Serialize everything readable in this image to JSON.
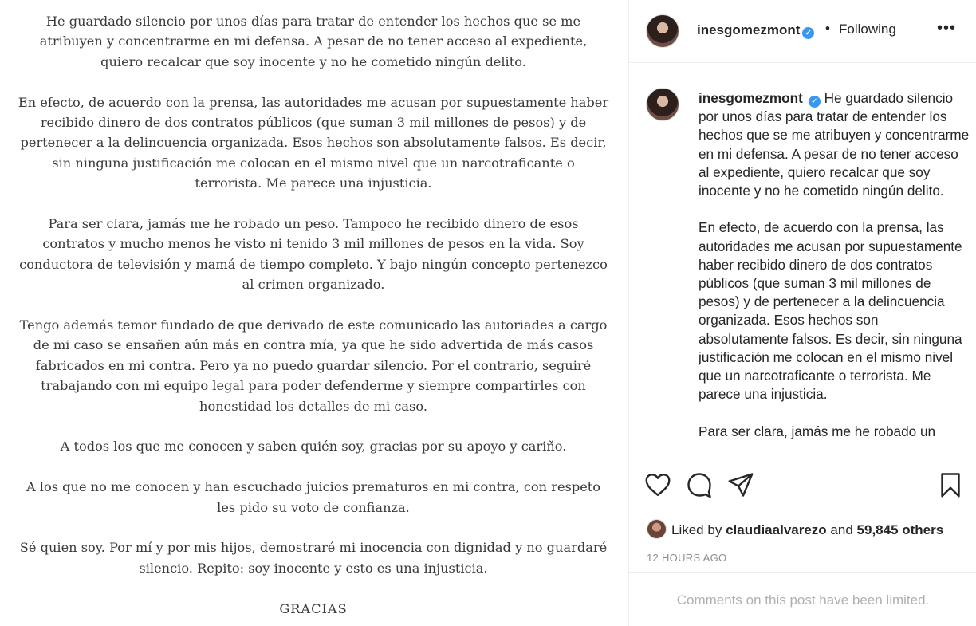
{
  "statement": {
    "paragraphs": [
      "He guardado silencio por unos días para tratar de entender los hechos que se me atribuyen y concentrarme en mi defensa. A pesar de no tener acceso al expediente, quiero recalcar que soy inocente y no he cometido ningún delito.",
      "En efecto, de acuerdo con la prensa, las autoridades me acusan por supuestamente haber recibido dinero de dos contratos públicos (que suman 3 mil millones de pesos) y de pertenecer a la delincuencia organizada. Esos hechos son absolutamente falsos. Es decir, sin ninguna justificación me colocan en el mismo nivel que un narcotraficante o terrorista. Me parece una injusticia.",
      "Para ser clara, jamás me he robado un peso. Tampoco he recibido dinero de esos contratos y mucho menos he visto ni tenido 3 mil millones de pesos en la vida. Soy conductora de televisión y mamá de tiempo completo. Y bajo ningún concepto pertenezco al crimen organizado.",
      "Tengo además temor fundado de que derivado de este comunicado las autoriades a cargo de mi caso se ensañen aún más en contra mía, ya que he sido advertida de más casos fabricados en mi contra. Pero ya no puedo guardar silencio. Por el contrario, seguiré trabajando con mi equipo legal para poder defenderme y siempre compartirles con honestidad los detalles de mi caso.",
      "A todos los que me conocen y saben quién soy, gracias por su apoyo y cariño.",
      "A los que no me conocen y han escuchado juicios prematuros en mi contra, con respeto les pido su voto de confianza.",
      "Sé quien soy. Por mí y por mis hijos, demostraré mi inocencia con dignidad y no guardaré silencio. Repito: soy inocente y esto es una injusticia."
    ],
    "closing": "GRACIAS"
  },
  "header": {
    "username": "inesgomezmont",
    "verified_mark": "✓",
    "separator": "•",
    "follow_status": "Following",
    "more_label": "•••"
  },
  "caption": {
    "username": "inesgomezmont",
    "paragraph_1": "He guardado silencio por unos días para tratar de entender los hechos que se me atribuyen y concentrarme en mi defensa. A pesar de no tener acceso al expediente, quiero recalcar que soy inocente y no he cometido ningún delito.",
    "paragraph_2": "En efecto, de acuerdo con la prensa, las autoridades me acusan por supuestamente haber recibido dinero de dos contratos públicos (que suman 3 mil millones de pesos) y de pertenecer a la delincuencia organizada. Esos hechos son absolutamente falsos. Es decir, sin ninguna justificación me colocan en el mismo nivel que un narcotraficante o terrorista. Me parece una injusticia.",
    "paragraph_3": "Para ser clara, jamás me he robado un"
  },
  "actions": {
    "icons": [
      "heart-icon",
      "comment-icon",
      "share-icon",
      "bookmark-icon"
    ]
  },
  "likes": {
    "prefix": "Liked by",
    "liker": "claudiaalvarezo",
    "conjunction": "and",
    "others": "59,845 others"
  },
  "timestamp": "12 HOURS AGO",
  "comments_notice": "Comments on this post have been limited.",
  "colors": {
    "verified": "#3897f0",
    "muted": "#8e8e8e",
    "border": "#efefef"
  }
}
